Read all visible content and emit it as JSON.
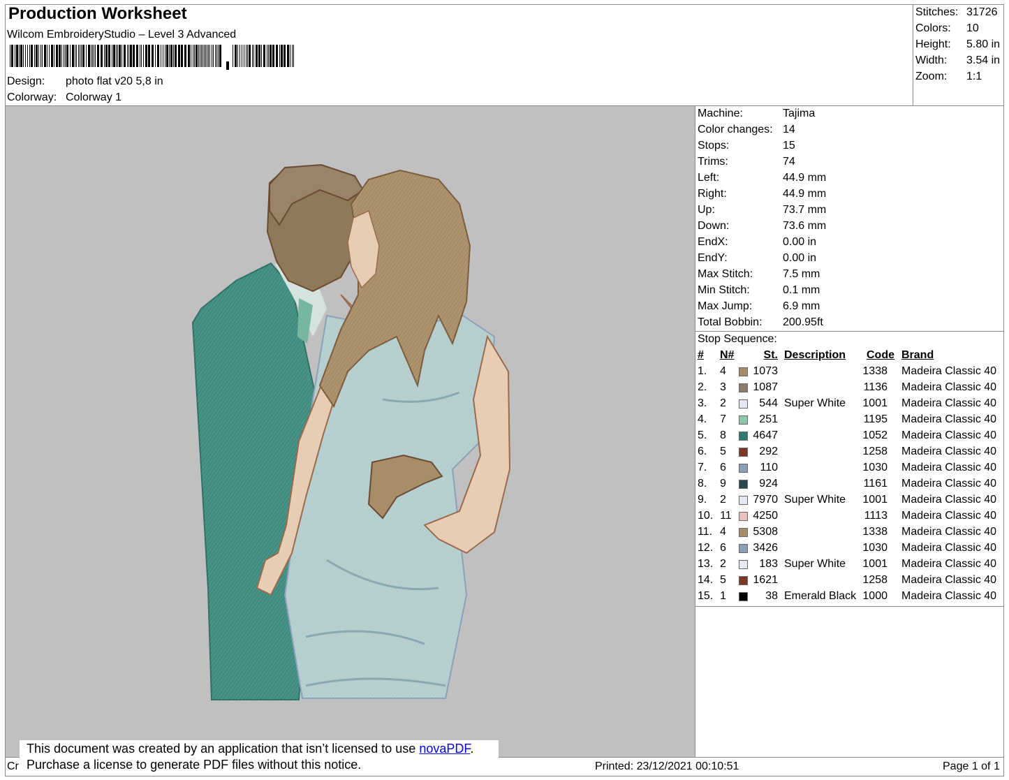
{
  "header": {
    "title": "Production Worksheet",
    "software": "Wilcom EmbroideryStudio – Level 3 Advanced",
    "design_label": "Design:",
    "design_value": "photo flat v20 5,8 in",
    "colorway_label": "Colorway:",
    "colorway_value": "Colorway 1"
  },
  "summary": [
    {
      "label": "Stitches:",
      "value": "31726"
    },
    {
      "label": "Colors:",
      "value": "10"
    },
    {
      "label": "Height:",
      "value": "5.80 in"
    },
    {
      "label": "Width:",
      "value": "3.54 in"
    },
    {
      "label": "Zoom:",
      "value": "1:1"
    }
  ],
  "details": [
    {
      "label": "Machine:",
      "value": "Tajima"
    },
    {
      "label": "Color changes:",
      "value": "14"
    },
    {
      "label": "Stops:",
      "value": "15"
    },
    {
      "label": "Trims:",
      "value": "74"
    },
    {
      "label": "Left:",
      "value": "44.9 mm"
    },
    {
      "label": "Right:",
      "value": "44.9 mm"
    },
    {
      "label": "Up:",
      "value": "73.7 mm"
    },
    {
      "label": "Down:",
      "value": "73.6 mm"
    },
    {
      "label": "EndX:",
      "value": "0.00 in"
    },
    {
      "label": "EndY:",
      "value": "0.00 in"
    },
    {
      "label": "Max Stitch:",
      "value": "7.5 mm"
    },
    {
      "label": "Min Stitch:",
      "value": "0.1 mm"
    },
    {
      "label": "Max Jump:",
      "value": "6.9 mm"
    },
    {
      "label": "Total Bobbin:",
      "value": "200.95ft"
    }
  ],
  "stop_sequence": {
    "title": "Stop Sequence:",
    "columns": {
      "num": "#",
      "n": "N#",
      "st": "St.",
      "description": "Description",
      "code": "Code",
      "brand": "Brand"
    },
    "rows": [
      {
        "num": "1.",
        "n": "4",
        "color": "#a58c66",
        "st": "1073",
        "description": "",
        "code": "1338",
        "brand": "Madeira Classic 40"
      },
      {
        "num": "2.",
        "n": "3",
        "color": "#8c7b6b",
        "st": "1087",
        "description": "",
        "code": "1136",
        "brand": "Madeira Classic 40"
      },
      {
        "num": "3.",
        "n": "2",
        "color": "#e6e8f2",
        "st": "544",
        "description": "Super White",
        "code": "1001",
        "brand": "Madeira Classic 40"
      },
      {
        "num": "4.",
        "n": "7",
        "color": "#8fc7ad",
        "st": "251",
        "description": "",
        "code": "1195",
        "brand": "Madeira Classic 40"
      },
      {
        "num": "5.",
        "n": "8",
        "color": "#2f7a70",
        "st": "4647",
        "description": "",
        "code": "1052",
        "brand": "Madeira Classic 40"
      },
      {
        "num": "6.",
        "n": "5",
        "color": "#7a3a25",
        "st": "292",
        "description": "",
        "code": "1258",
        "brand": "Madeira Classic 40"
      },
      {
        "num": "7.",
        "n": "6",
        "color": "#8aa0b8",
        "st": "110",
        "description": "",
        "code": "1030",
        "brand": "Madeira Classic 40"
      },
      {
        "num": "8.",
        "n": "9",
        "color": "#2e4650",
        "st": "924",
        "description": "",
        "code": "1161",
        "brand": "Madeira Classic 40"
      },
      {
        "num": "9.",
        "n": "2",
        "color": "#e6e8f2",
        "st": "7970",
        "description": "Super White",
        "code": "1001",
        "brand": "Madeira Classic 40"
      },
      {
        "num": "10.",
        "n": "11",
        "color": "#e8c2bd",
        "st": "4250",
        "description": "",
        "code": "1113",
        "brand": "Madeira Classic 40"
      },
      {
        "num": "11.",
        "n": "4",
        "color": "#a58c66",
        "st": "5308",
        "description": "",
        "code": "1338",
        "brand": "Madeira Classic 40"
      },
      {
        "num": "12.",
        "n": "6",
        "color": "#8aa0b8",
        "st": "3426",
        "description": "",
        "code": "1030",
        "brand": "Madeira Classic 40"
      },
      {
        "num": "13.",
        "n": "2",
        "color": "#e6e8f2",
        "st": "183",
        "description": "Super White",
        "code": "1001",
        "brand": "Madeira Classic 40"
      },
      {
        "num": "14.",
        "n": "5",
        "color": "#7a3a25",
        "st": "1621",
        "description": "",
        "code": "1258",
        "brand": "Madeira Classic 40"
      },
      {
        "num": "15.",
        "n": "1",
        "color": "#000000",
        "st": "38",
        "description": "Emerald Black",
        "code": "1000",
        "brand": "Madeira Classic 40"
      }
    ]
  },
  "notice": {
    "line1": "This document was created by an application that isn’t licensed to use",
    "link": "novaPDF",
    "line1_end": ".",
    "line2": "Purchase a license to generate PDF files without this notice."
  },
  "footer": {
    "left": "Cr",
    "printed": "Printed: 23/12/2021 00:10:51",
    "page": "Page 1 of 1"
  }
}
